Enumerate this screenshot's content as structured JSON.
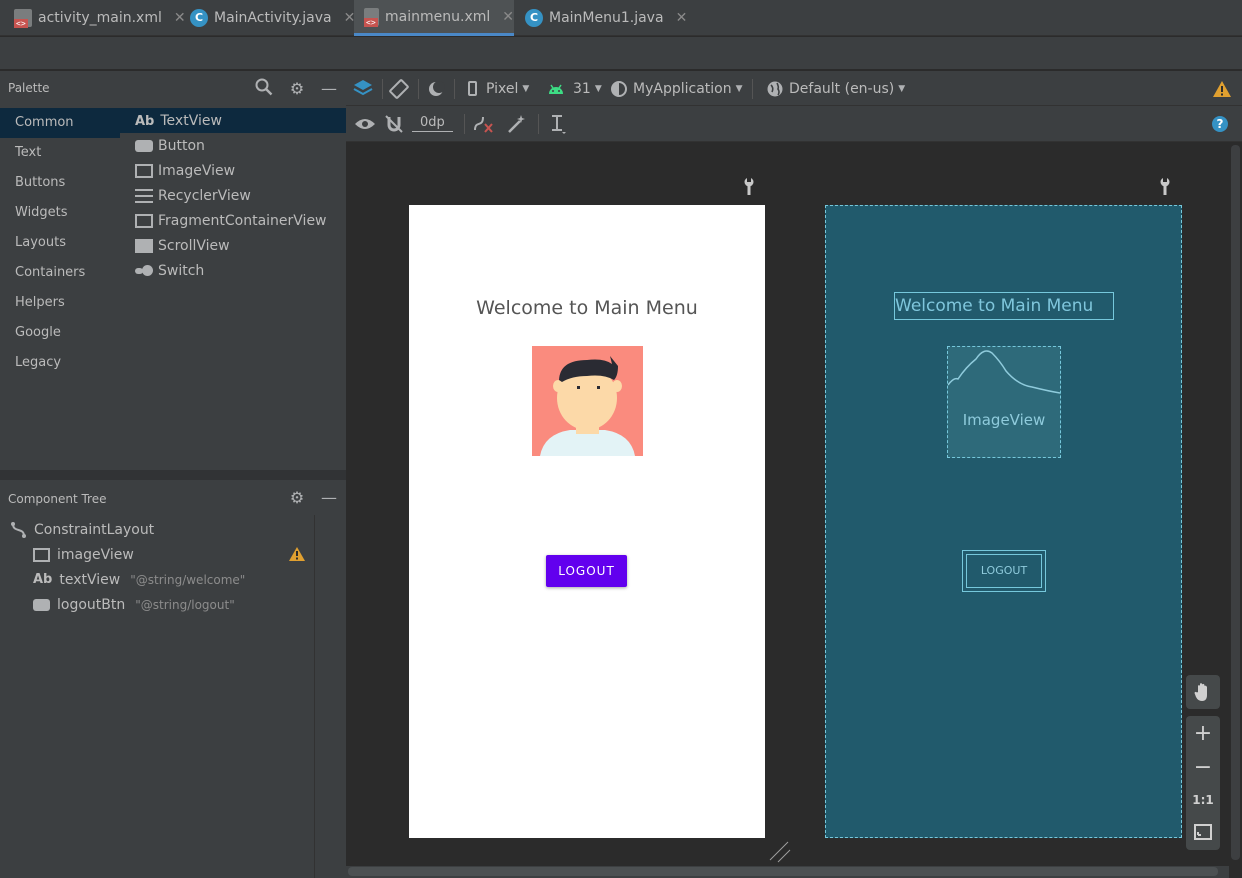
{
  "tabs": [
    {
      "label": "activity_main.xml",
      "icon": "xml-file-icon",
      "active": false
    },
    {
      "label": "MainActivity.java",
      "icon": "java-class-icon",
      "active": false
    },
    {
      "label": "mainmenu.xml",
      "icon": "xml-file-icon",
      "active": true
    },
    {
      "label": "MainMenu1.java",
      "icon": "java-class-icon",
      "active": false
    }
  ],
  "palette": {
    "title": "Palette",
    "categories": [
      "Common",
      "Text",
      "Buttons",
      "Widgets",
      "Layouts",
      "Containers",
      "Helpers",
      "Google",
      "Legacy"
    ],
    "items": [
      {
        "prefix": "Ab",
        "label": "TextView"
      },
      {
        "label": "Button"
      },
      {
        "label": "ImageView"
      },
      {
        "label": "RecyclerView"
      },
      {
        "label": "FragmentContainerView"
      },
      {
        "label": "ScrollView"
      },
      {
        "label": "Switch"
      }
    ]
  },
  "component_tree": {
    "title": "Component Tree",
    "root": "ConstraintLayout",
    "children": [
      {
        "label": "imageView",
        "attr": "",
        "warning": true
      },
      {
        "prefix": "Ab",
        "label": "textView",
        "attr": "\"@string/welcome\""
      },
      {
        "label": "logoutBtn",
        "attr": "\"@string/logout\""
      }
    ]
  },
  "toolbar": {
    "device": "Pixel",
    "api": "31",
    "theme": "MyApplication",
    "locale": "Default (en-us)",
    "margin": "0dp"
  },
  "design": {
    "welcome_text": "Welcome to Main Menu",
    "logout_text": "LOGOUT"
  },
  "blueprint": {
    "welcome_text": "Welcome to Main Menu",
    "image_label": "ImageView",
    "logout_text": "LOGOUT"
  },
  "zoom": {
    "reset_label": "1:1"
  },
  "colors": {
    "button": "#6200ee",
    "blueprint_bg": "#215a6c",
    "selection": "#0d293e",
    "warning": "#e0a030"
  }
}
